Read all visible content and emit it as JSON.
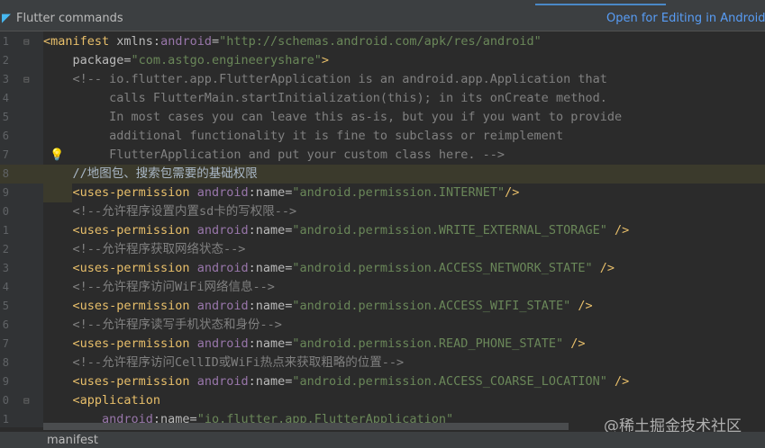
{
  "toolbar": {
    "title": "Flutter commands",
    "open_link": "Open for Editing in Android St"
  },
  "lines": [
    [
      [
        "tag",
        "<manifest"
      ],
      [
        "attr",
        " xmlns:"
      ],
      [
        "ns",
        "android"
      ],
      [
        "attr",
        "="
      ],
      [
        "val",
        "\"http://schemas.android.com/apk/res/android\""
      ]
    ],
    [
      [
        "attr",
        "    package"
      ],
      [
        "attr",
        "="
      ],
      [
        "val",
        "\"com.astgo.engineeryshare\""
      ],
      [
        "tag",
        ">"
      ]
    ],
    [
      [
        "com",
        "    <!-- io.flutter.app.FlutterApplication is an android.app.Application that"
      ]
    ],
    [
      [
        "com",
        "         calls FlutterMain.startInitialization(this); in its onCreate method."
      ]
    ],
    [
      [
        "com",
        "         In most cases you can leave this as-is, but you if you want to provide"
      ]
    ],
    [
      [
        "com",
        "         additional functionality it is fine to subclass or reimplement"
      ]
    ],
    [
      [
        "com",
        "         FlutterApplication and put your custom class here. -->"
      ]
    ],
    [
      [
        "text",
        "    //地图包、搜索包需要的基础权限"
      ]
    ],
    [
      [
        "tag",
        "    <uses-permission"
      ],
      [
        "ns",
        " android"
      ],
      [
        "attr",
        ":name="
      ],
      [
        "val",
        "\"android.permission.INTERNET\""
      ],
      [
        "tag",
        "/>"
      ]
    ],
    [
      [
        "com",
        "    <!--允许程序设置内置sd卡的写权限-->"
      ]
    ],
    [
      [
        "tag",
        "    <uses-permission"
      ],
      [
        "ns",
        " android"
      ],
      [
        "attr",
        ":name="
      ],
      [
        "val",
        "\"android.permission.WRITE_EXTERNAL_STORAGE\""
      ],
      [
        "tag",
        " />"
      ]
    ],
    [
      [
        "com",
        "    <!--允许程序获取网络状态-->"
      ]
    ],
    [
      [
        "tag",
        "    <uses-permission"
      ],
      [
        "ns",
        " android"
      ],
      [
        "attr",
        ":name="
      ],
      [
        "val",
        "\"android.permission.ACCESS_NETWORK_STATE\""
      ],
      [
        "tag",
        " />"
      ]
    ],
    [
      [
        "com",
        "    <!--允许程序访问WiFi网络信息-->"
      ]
    ],
    [
      [
        "tag",
        "    <uses-permission"
      ],
      [
        "ns",
        " android"
      ],
      [
        "attr",
        ":name="
      ],
      [
        "val",
        "\"android.permission.ACCESS_WIFI_STATE\""
      ],
      [
        "tag",
        " />"
      ]
    ],
    [
      [
        "com",
        "    <!--允许程序读写手机状态和身份-->"
      ]
    ],
    [
      [
        "tag",
        "    <uses-permission"
      ],
      [
        "ns",
        " android"
      ],
      [
        "attr",
        ":name="
      ],
      [
        "val",
        "\"android.permission.READ_PHONE_STATE\""
      ],
      [
        "tag",
        " />"
      ]
    ],
    [
      [
        "com",
        "    <!--允许程序访问CellID或WiFi热点来获取粗略的位置-->"
      ]
    ],
    [
      [
        "tag",
        "    <uses-permission"
      ],
      [
        "ns",
        " android"
      ],
      [
        "attr",
        ":name="
      ],
      [
        "val",
        "\"android.permission.ACCESS_COARSE_LOCATION\""
      ],
      [
        "tag",
        " />"
      ]
    ],
    [
      [
        "tag",
        "    <application"
      ]
    ],
    [
      [
        "ns",
        "        android"
      ],
      [
        "attr",
        ":name="
      ],
      [
        "val",
        "\"io.flutter.app.FlutterApplication\""
      ]
    ]
  ],
  "line_numbers": [
    "1",
    "2",
    "3",
    "4",
    "5",
    "6",
    "7",
    "8",
    "9",
    "0",
    "1",
    "2",
    "3",
    "4",
    "5",
    "6",
    "7",
    "8",
    "9",
    "0",
    "1"
  ],
  "status": {
    "breadcrumb": "manifest"
  },
  "watermark": "@稀土掘金技术社区"
}
